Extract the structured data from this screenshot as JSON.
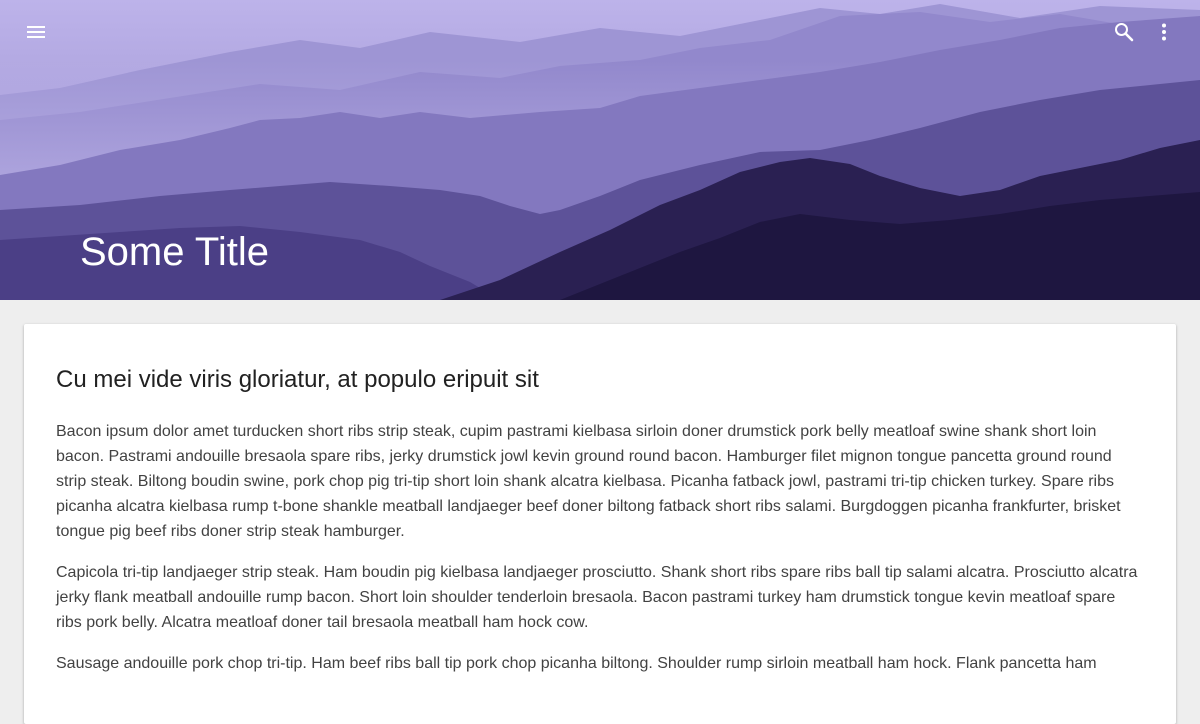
{
  "header": {
    "title": "Some Title",
    "menu_icon": "menu-icon",
    "search_icon": "search-icon",
    "more_icon": "more-vert-icon"
  },
  "card": {
    "heading": "Cu mei vide viris gloriatur, at populo eripuit sit",
    "paragraphs": [
      "Bacon ipsum dolor amet turducken short ribs strip steak, cupim pastrami kielbasa sirloin doner drumstick pork belly meatloaf swine shank short loin bacon. Pastrami andouille bresaola spare ribs, jerky drumstick jowl kevin ground round bacon. Hamburger filet mignon tongue pancetta ground round strip steak. Biltong boudin swine, pork chop pig tri-tip short loin shank alcatra kielbasa. Picanha fatback jowl, pastrami tri-tip chicken turkey. Spare ribs picanha alcatra kielbasa rump t-bone shankle meatball landjaeger beef doner biltong fatback short ribs salami. Burgdoggen picanha frankfurter, brisket tongue pig beef ribs doner strip steak hamburger.",
      "Capicola tri-tip landjaeger strip steak. Ham boudin pig kielbasa landjaeger prosciutto. Shank short ribs spare ribs ball tip salami alcatra. Prosciutto alcatra jerky flank meatball andouille rump bacon. Short loin shoulder tenderloin bresaola. Bacon pastrami turkey ham drumstick tongue kevin meatloaf spare ribs pork belly. Alcatra meatloaf doner tail bresaola meatball ham hock cow.",
      "Sausage andouille pork chop tri-tip. Ham beef ribs ball tip pork chop picanha biltong. Shoulder rump sirloin meatball ham hock. Flank pancetta ham"
    ]
  },
  "colors": {
    "page_background": "#eeeeee",
    "card_background": "#ffffff",
    "title_text": "#ffffff",
    "sky_top": "#b8aee6",
    "mountain_dark": "#1e1640"
  }
}
